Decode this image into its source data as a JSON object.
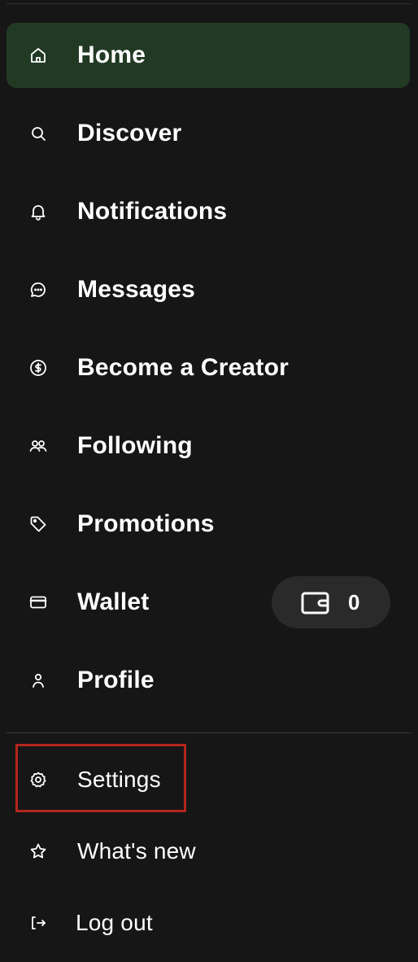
{
  "nav": {
    "items": [
      {
        "label": "Home",
        "icon": "home-icon",
        "active": true
      },
      {
        "label": "Discover",
        "icon": "search-icon"
      },
      {
        "label": "Notifications",
        "icon": "bell-icon"
      },
      {
        "label": "Messages",
        "icon": "chat-bubble-icon"
      },
      {
        "label": "Become a Creator",
        "icon": "dollar-circle-icon"
      },
      {
        "label": "Following",
        "icon": "users-icon"
      },
      {
        "label": "Promotions",
        "icon": "tag-icon"
      },
      {
        "label": "Wallet",
        "icon": "credit-card-icon"
      },
      {
        "label": "Profile",
        "icon": "user-icon"
      }
    ],
    "wallet_balance": "0"
  },
  "secondary": {
    "items": [
      {
        "label": "Settings",
        "icon": "gear-icon"
      },
      {
        "label": "What's new",
        "icon": "star-icon"
      },
      {
        "label": "Log out",
        "icon": "logout-icon"
      }
    ]
  },
  "colors": {
    "background": "#161616",
    "active_item": "#223a24",
    "highlight_border": "#b3261e"
  }
}
